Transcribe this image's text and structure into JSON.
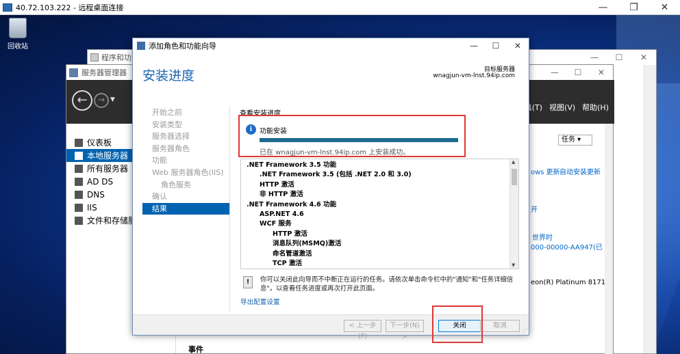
{
  "rdp": {
    "title": "40.72.103.222 - 远程桌面连接",
    "minimize": "—",
    "restore": "❐",
    "close": "✕"
  },
  "desktop": {
    "recycle_bin": "回收站"
  },
  "programs_window": {
    "title": "程序和功能"
  },
  "server_manager": {
    "title": "服务器管理器",
    "menus": [
      "工具(T)",
      "视图(V)",
      "帮助(H)"
    ],
    "nav": [
      {
        "label": "仪表板",
        "icon": "dashboard-icon"
      },
      {
        "label": "本地服务器",
        "icon": "server-icon"
      },
      {
        "label": "所有服务器",
        "icon": "servers-icon"
      },
      {
        "label": "AD DS",
        "icon": "ad-icon"
      },
      {
        "label": "DNS",
        "icon": "dns-icon"
      },
      {
        "label": "IIS",
        "icon": "iis-icon"
      },
      {
        "label": "文件和存储服务",
        "icon": "storage-icon"
      }
    ],
    "task_button": "任务",
    "partials": {
      "windows_update": "ows 更新",
      "auto_install": "自动安装更新",
      "open": "开",
      "world_time": "世界时",
      "product_id": "000-00000-AA947(已",
      "cpu": "eon(R) Platinum 8171"
    },
    "events": "事件"
  },
  "wizard": {
    "window_title": "添加角色和功能向导",
    "heading": "安装进度",
    "target_server_label": "目标服务器",
    "target_server": "wnagjun-vm-lnst.94ip.com",
    "steps": [
      {
        "label": "开始之前",
        "sub": false,
        "active": false
      },
      {
        "label": "安装类型",
        "sub": false,
        "active": false
      },
      {
        "label": "服务器选择",
        "sub": false,
        "active": false
      },
      {
        "label": "服务器角色",
        "sub": false,
        "active": false
      },
      {
        "label": "功能",
        "sub": false,
        "active": false
      },
      {
        "label": "Web 服务器角色(IIS)",
        "sub": false,
        "active": false
      },
      {
        "label": "角色服务",
        "sub": true,
        "active": false
      },
      {
        "label": "确认",
        "sub": false,
        "active": false
      },
      {
        "label": "结果",
        "sub": false,
        "active": true
      }
    ],
    "view_progress": "查看安装进度",
    "feature_install": "功能安装",
    "progress_fraction": 1.0,
    "success_msg": "已在 wnagjun-vm-lnst.94ip.com 上安装成功。",
    "features": [
      {
        "label": ".NET Framework 3.5 功能",
        "level": 0
      },
      {
        "label": ".NET Framework 3.5 (包括 .NET 2.0 和 3.0)",
        "level": 1
      },
      {
        "label": "HTTP 激活",
        "level": 1
      },
      {
        "label": "非 HTTP 激活",
        "level": 1
      },
      {
        "label": ".NET Framework 4.6 功能",
        "level": 0
      },
      {
        "label": "ASP.NET 4.6",
        "level": 1
      },
      {
        "label": "WCF 服务",
        "level": 1
      },
      {
        "label": "HTTP 激活",
        "level": 2
      },
      {
        "label": "消息队列(MSMQ)激活",
        "level": 2
      },
      {
        "label": "命名管道激活",
        "level": 2
      },
      {
        "label": "TCP 激活",
        "level": 2
      }
    ],
    "note": "你可以关闭此向导而不中断正在运行的任务。请依次单击命令栏中的\"通知\"和\"任务详细信息\"，以查看任务进度或再次打开此页面。",
    "export_link": "导出配置设置",
    "buttons": {
      "prev": "< 上一步(P)",
      "next": "下一步(N) >",
      "close": "关闭",
      "cancel": "取消"
    }
  }
}
